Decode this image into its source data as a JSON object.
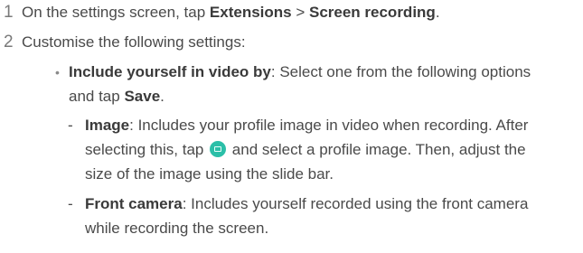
{
  "step1": {
    "number": "1",
    "pre": "On the settings screen, tap ",
    "b1": "Extensions",
    "sep": " > ",
    "b2": "Screen recording",
    "post": "."
  },
  "step2": {
    "number": "2",
    "text": "Customise the following settings:"
  },
  "bullet": {
    "marker": "•",
    "title": "Include yourself in video by",
    "line1": ": Select one from the following options",
    "line2_pre": "and tap ",
    "save": "Save",
    "line2_post": "."
  },
  "sub_image": {
    "marker": "-",
    "title": "Image",
    "line1": ": Includes your profile image in video when recording. After",
    "line2_pre": "selecting this, tap ",
    "icon": "camera-icon",
    "line2_post": " and select a profile image. Then, adjust the",
    "line3": "size of the image using the slide bar."
  },
  "sub_front": {
    "marker": "-",
    "title": "Front camera",
    "line1": ": Includes yourself recorded using the front camera",
    "line2": "while recording the screen."
  }
}
